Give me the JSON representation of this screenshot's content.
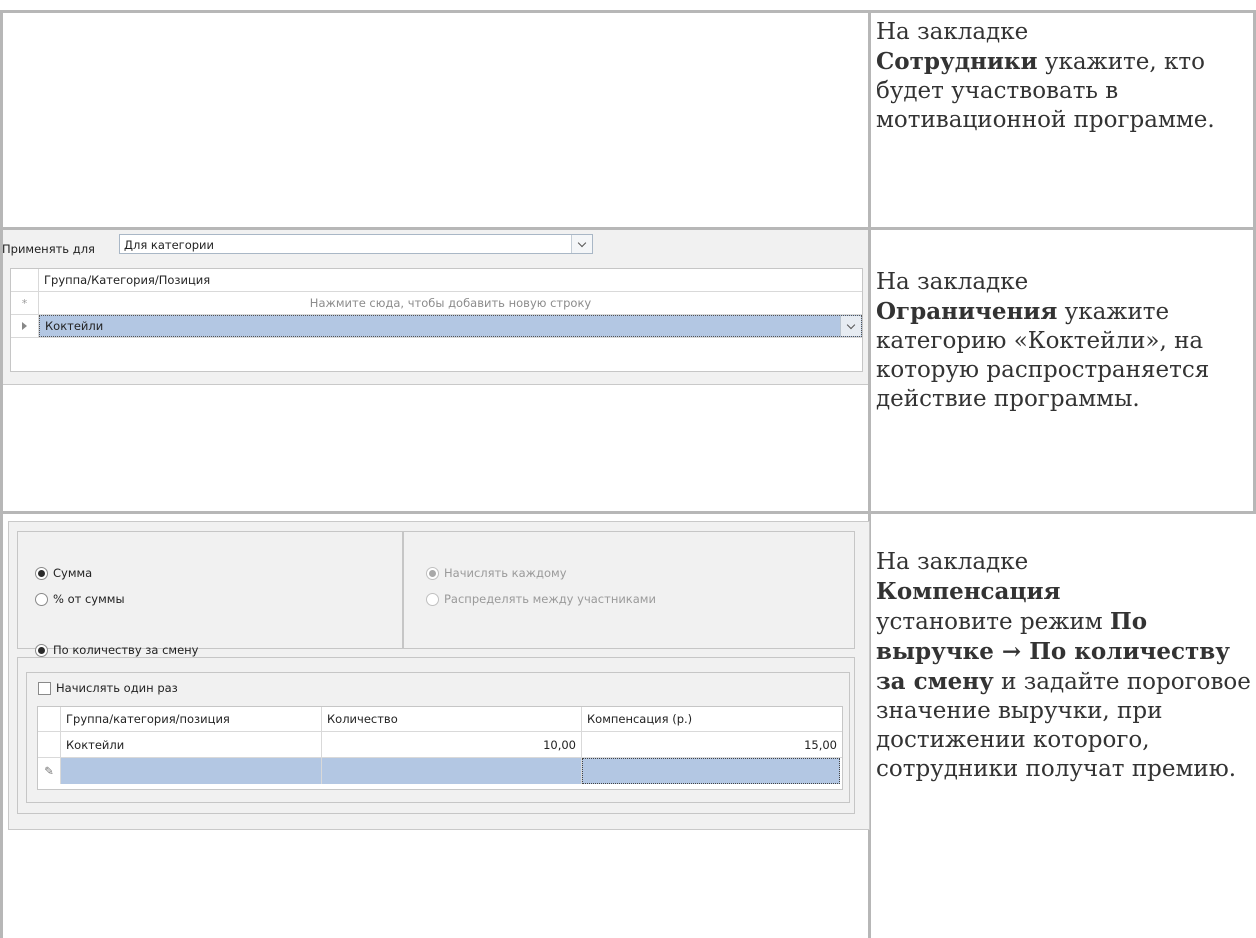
{
  "rows": [
    {
      "description": {
        "prefix": "На закладке",
        "bold": "Сотрудники",
        "suffix": " укажите, кто будет участвовать в мотивационной программе."
      }
    },
    {
      "description": {
        "prefix": "На закладке",
        "bold": "Ограничения",
        "suffix": " укажите категорию «Коктейли», на которую распространяется действие программы."
      },
      "ui": {
        "apply_label": "Применять для",
        "apply_value": "Для категории",
        "grid": {
          "header": "Группа/Категория/Позиция",
          "new_row_marker": "*",
          "new_row_hint": "Нажмите сюда, чтобы добавить новую строку",
          "rows": [
            "Коктейли"
          ]
        }
      }
    },
    {
      "description": {
        "prefix": "На закладке",
        "bold1": "Компенсация",
        "mid": " установите режим ",
        "bold2": "По выручке → По количеству за смену",
        "suffix": " и задайте пороговое значение выручки, при достижении которого, сотрудники получат премию."
      },
      "ui": {
        "radio_sum": "Сумма",
        "radio_percent": "% от суммы",
        "radio_each": "Начислять каждому",
        "radio_distribute": "Распределять между участниками",
        "radio_by_quantity": "По количеству за смену",
        "checkbox_once": "Начислять один раз",
        "grid": {
          "columns": [
            "Группа/категория/позиция",
            "Количество",
            "Компенсация (р.)"
          ],
          "rows": [
            {
              "item": "Коктейли",
              "quantity": "10,00",
              "compensation": "15,00"
            }
          ],
          "new_row_marker": "✎"
        }
      }
    }
  ]
}
